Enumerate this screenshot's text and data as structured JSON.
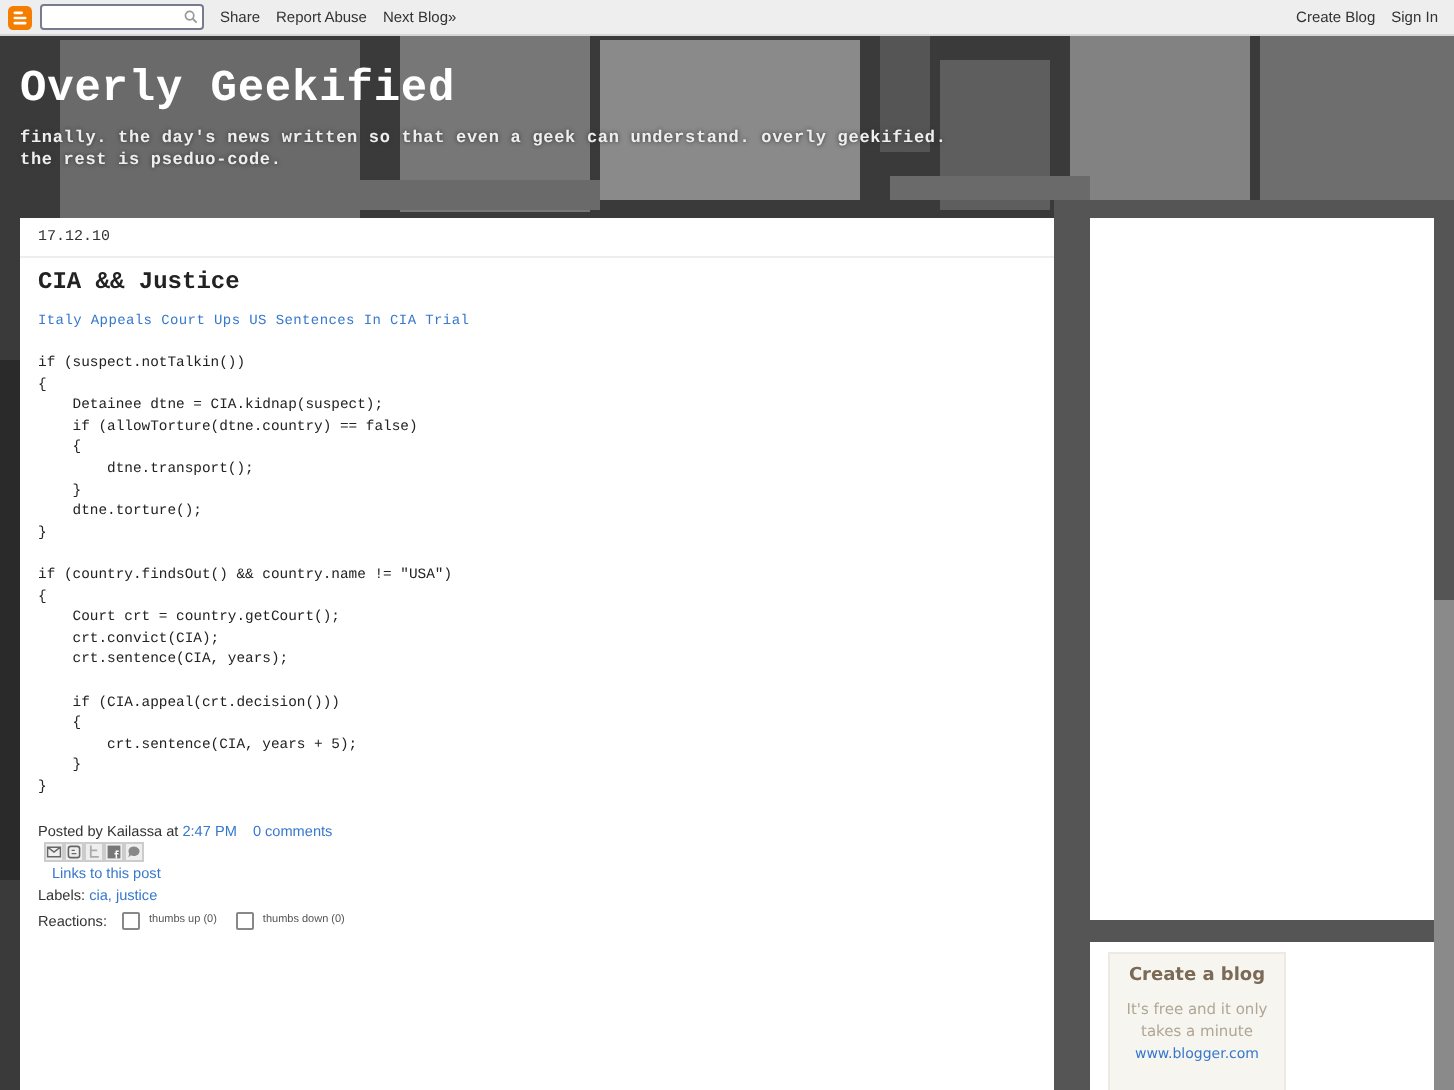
{
  "navbar": {
    "links": [
      "Share",
      "Report Abuse",
      "Next Blog»"
    ],
    "right_links": [
      "Create Blog",
      "Sign In"
    ]
  },
  "header": {
    "title": "Overly Geekified",
    "description": [
      "finally. the day's news written so that even a geek can understand. overly geekified.",
      "the rest is pseduo-code."
    ]
  },
  "post": {
    "date": "17.12.10",
    "title": "CIA && Justice",
    "link": "Italy Appeals Court Ups US Sentences In CIA Trial",
    "code_blocks": [
      [
        "if (suspect.notTalkin())",
        "{",
        "    Detainee dtne = CIA.kidnap(suspect);",
        "    if (allowTorture(dtne.country) == false)",
        "    {",
        "        dtne.transport();",
        "    }",
        "    dtne.torture();",
        "}"
      ],
      [
        "if (country.findsOut() && country.name != \"USA\")",
        "{",
        "    Court crt = country.getCourt();",
        "    crt.convict(CIA);",
        "    crt.sentence(CIA, years);"
      ],
      [
        "    if (CIA.appeal(crt.decision()))",
        "    {",
        "        crt.sentence(CIA, years + 5);",
        "    }",
        "}"
      ]
    ],
    "posted_by": "Posted by Kailassa at",
    "time": "2:47 PM",
    "comments": "0 comments",
    "share_buttons": [
      {
        "kind": "email"
      },
      {
        "kind": "blog"
      },
      {
        "kind": "twitter"
      },
      {
        "kind": "facebook"
      },
      {
        "kind": "buzz"
      }
    ],
    "links_to_post": "Links to this post",
    "labels_prefix": "Labels:",
    "labels": [
      "cia,",
      "justice"
    ],
    "reactions_label": "Reactions:",
    "reactions": [
      {
        "label": "thumbs up (0)",
        "checked": false
      },
      {
        "label": "thumbs down (0)",
        "checked": false
      }
    ]
  },
  "sidebar_ad": {
    "title": "Create a blog",
    "text": "It's free and it only takes a minute",
    "link": "www.blogger.com"
  }
}
